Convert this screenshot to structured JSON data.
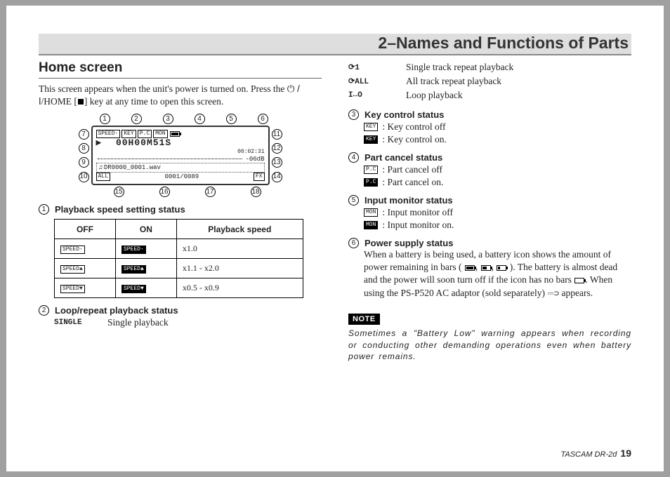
{
  "chapter_title": "2–Names and Functions of Parts",
  "section": {
    "title": "Home screen",
    "intro_a": "This screen appears when the unit's power is turned on. Press the ",
    "intro_b": "/HOME [",
    "intro_c": "] key at any time to open this screen."
  },
  "diagram": {
    "top_nums": [
      "1",
      "2",
      "3",
      "4",
      "5",
      "6"
    ],
    "left_nums": [
      "7",
      "8",
      "9",
      "10"
    ],
    "right_nums": [
      "11",
      "12",
      "13",
      "14"
    ],
    "bottom_nums": [
      "15",
      "16",
      "17",
      "18"
    ],
    "r1_tags": [
      "SPEED-",
      "KEY",
      "P.C",
      "MON"
    ],
    "r2_time": "00H00M51S",
    "r3_elapsed": "00:02:31",
    "r4_db": "-06dB",
    "r5_file": "DR0000_0001.wav",
    "r6_a": "ALL",
    "r6_b": "0001/0089",
    "r6_c": "FX"
  },
  "items": {
    "i1_title": "Playback speed setting status",
    "i2_title": "Loop/repeat playback status",
    "i3_title": "Key control status",
    "i3_off": ": Key control off",
    "i3_on": ": Key control on.",
    "i4_title": "Part cancel status",
    "i4_off": ": Part cancel off",
    "i4_on": ": Part cancel on.",
    "i5_title": "Input monitor status",
    "i5_off": ": Input monitor off",
    "i5_on": ": Input monitor on.",
    "i6_title": "Power supply status",
    "i6_body_a": "When a battery is being used, a battery icon shows the amount of power remaining in bars (",
    "i6_body_b": "). The battery is almost dead and the power will soon turn off if the icon has no bars ",
    "i6_body_c": " When using the PS-P520 AC adaptor (sold separately) ",
    "i6_body_d": " appears."
  },
  "speed_table": {
    "h1": "OFF",
    "h2": "ON",
    "h3": "Playback speed",
    "r1_off": "SPEED-",
    "r1_on": "SPEED-",
    "r1_sp": "x1.0",
    "r2_off": "SPEED▲",
    "r2_on": "SPEED▲",
    "r2_sp": "x1.1 - x2.0",
    "r3_off": "SPEED▼",
    "r3_on": "SPEED▼",
    "r3_sp": "x0.5 - x0.9"
  },
  "repeat": {
    "r0_sym": "SINGLE",
    "r0_txt": "Single playback",
    "r1_sym": "⟳1",
    "r1_txt": "Single track repeat playback",
    "r2_sym": "⟳ALL",
    "r2_txt": "All track repeat playback",
    "r3_sym": "I↔O",
    "r3_txt": "Loop playback"
  },
  "tags": {
    "key": "KEY",
    "pc": "P.C",
    "mon": "MON"
  },
  "note_label": "NOTE",
  "note_text": "Sometimes a \"Battery Low\" warning appears when recording or conducting other demanding operations even when battery power remains.",
  "footer_model": "TASCAM  DR-2d",
  "footer_page": "19"
}
